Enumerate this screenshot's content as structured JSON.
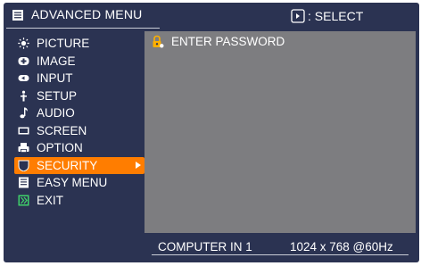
{
  "header": {
    "title": "ADVANCED MENU",
    "select_hint": ": SELECT",
    "icons": [
      "menu-icon",
      "dpad-select-icon"
    ]
  },
  "menu": {
    "items": [
      {
        "label": "PICTURE",
        "icon": "sun-icon"
      },
      {
        "label": "IMAGE",
        "icon": "image-icon"
      },
      {
        "label": "INPUT",
        "icon": "input-icon"
      },
      {
        "label": "SETUP",
        "icon": "setup-icon"
      },
      {
        "label": "AUDIO",
        "icon": "music-note-icon"
      },
      {
        "label": "SCREEN",
        "icon": "screen-icon"
      },
      {
        "label": "OPTION",
        "icon": "option-icon"
      },
      {
        "label": "SECURITY",
        "icon": "shield-icon",
        "selected": true
      },
      {
        "label": "EASY MENU",
        "icon": "easy-menu-icon"
      },
      {
        "label": "EXIT",
        "icon": "exit-icon"
      }
    ]
  },
  "content": {
    "items": [
      {
        "label": "ENTER PASSWORD",
        "icon": "lock-icon"
      }
    ]
  },
  "footer": {
    "source": "COMPUTER IN 1",
    "signal": "1024 x 768 @60Hz"
  },
  "colors": {
    "panel": "#2b3352",
    "content": "#7d7d80",
    "highlight": "#ff7d00",
    "text": "#ffffff"
  }
}
